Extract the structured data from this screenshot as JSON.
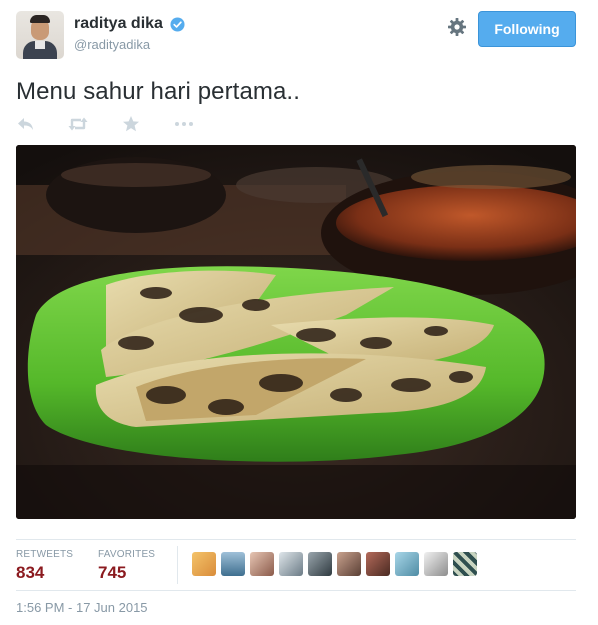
{
  "user": {
    "display_name": "raditya dika",
    "screen_name": "@radityadika",
    "verified": true
  },
  "header": {
    "follow_button_label": "Following",
    "settings_icon": "gear-icon"
  },
  "tweet": {
    "text": "Menu sahur hari pertama.."
  },
  "actions": [
    {
      "name": "reply",
      "icon": "reply-icon"
    },
    {
      "name": "retweet",
      "icon": "retweet-icon"
    },
    {
      "name": "favorite",
      "icon": "star-icon"
    },
    {
      "name": "more",
      "icon": "more-icon"
    }
  ],
  "media": {
    "icon": "photo-food-plate"
  },
  "stats": {
    "retweets_label": "RETWEETS",
    "retweets_count": "834",
    "favorites_label": "FAVORITES",
    "favorites_count": "745"
  },
  "favoriters_count_shown": 10,
  "timestamp": "1:56 PM - 17 Jun 2015",
  "colors": {
    "accent": "#55acee",
    "count": "#8b1a1f",
    "muted": "#8899a6",
    "text": "#292f33"
  }
}
